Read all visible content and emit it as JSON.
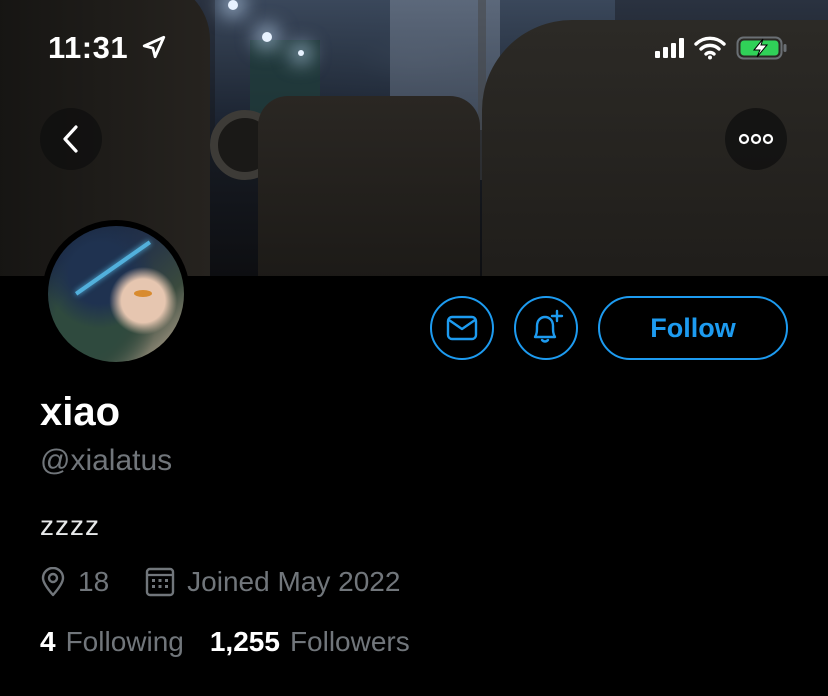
{
  "status_bar": {
    "time": "11:31"
  },
  "profile": {
    "display_name": "xiao",
    "handle": "@xialatus",
    "bio": "zzzz",
    "location": "18",
    "joined": "Joined May 2022"
  },
  "actions": {
    "follow_label": "Follow"
  },
  "stats": {
    "following_count": "4",
    "following_label": "Following",
    "followers_count": "1,255",
    "followers_label": "Followers"
  },
  "colors": {
    "accent": "#1d9bf0",
    "background": "#000000",
    "secondary_text": "#71767b"
  },
  "icons": [
    "location-arrow-icon",
    "signal-icon",
    "wifi-icon",
    "battery-charging-icon",
    "back-icon",
    "more-icon",
    "mail-icon",
    "bell-plus-icon",
    "location-icon",
    "calendar-icon"
  ]
}
